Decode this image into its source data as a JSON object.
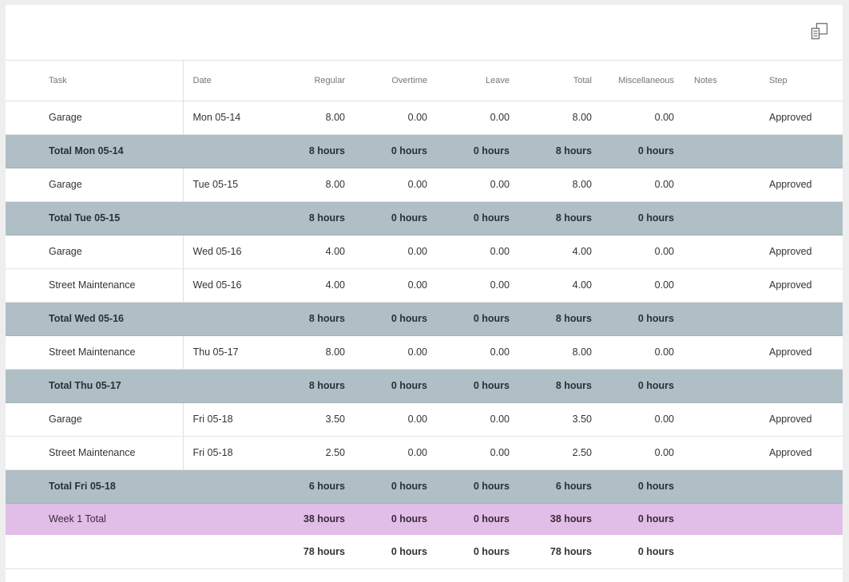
{
  "toolbar": {
    "export_icon": "columns-icon"
  },
  "columns": {
    "task": "Task",
    "date": "Date",
    "regular": "Regular",
    "overtime": "Overtime",
    "leave": "Leave",
    "total": "Total",
    "misc": "Miscellaneous",
    "notes": "Notes",
    "step": "Step"
  },
  "rows": [
    {
      "type": "entry",
      "task": "Garage",
      "date": "Mon 05-14",
      "regular": "8.00",
      "overtime": "0.00",
      "leave": "0.00",
      "total": "8.00",
      "misc": "0.00",
      "notes": "",
      "step": "Approved"
    },
    {
      "type": "subtotal",
      "label": "Total Mon 05-14",
      "regular": "8 hours",
      "overtime": "0 hours",
      "leave": "0 hours",
      "total": "8 hours",
      "misc": "0 hours"
    },
    {
      "type": "entry",
      "task": "Garage",
      "date": "Tue 05-15",
      "regular": "8.00",
      "overtime": "0.00",
      "leave": "0.00",
      "total": "8.00",
      "misc": "0.00",
      "notes": "",
      "step": "Approved"
    },
    {
      "type": "subtotal",
      "label": "Total Tue 05-15",
      "regular": "8 hours",
      "overtime": "0 hours",
      "leave": "0 hours",
      "total": "8 hours",
      "misc": "0 hours"
    },
    {
      "type": "entry",
      "task": "Garage",
      "date": "Wed 05-16",
      "regular": "4.00",
      "overtime": "0.00",
      "leave": "0.00",
      "total": "4.00",
      "misc": "0.00",
      "notes": "",
      "step": "Approved"
    },
    {
      "type": "entry",
      "task": "Street Maintenance",
      "date": "Wed 05-16",
      "regular": "4.00",
      "overtime": "0.00",
      "leave": "0.00",
      "total": "4.00",
      "misc": "0.00",
      "notes": "",
      "step": "Approved"
    },
    {
      "type": "subtotal",
      "label": "Total Wed 05-16",
      "regular": "8 hours",
      "overtime": "0 hours",
      "leave": "0 hours",
      "total": "8 hours",
      "misc": "0 hours"
    },
    {
      "type": "entry",
      "task": "Street Maintenance",
      "date": "Thu 05-17",
      "regular": "8.00",
      "overtime": "0.00",
      "leave": "0.00",
      "total": "8.00",
      "misc": "0.00",
      "notes": "",
      "step": "Approved"
    },
    {
      "type": "subtotal",
      "label": "Total Thu 05-17",
      "regular": "8 hours",
      "overtime": "0 hours",
      "leave": "0 hours",
      "total": "8 hours",
      "misc": "0 hours"
    },
    {
      "type": "entry",
      "task": "Garage",
      "date": "Fri 05-18",
      "regular": "3.50",
      "overtime": "0.00",
      "leave": "0.00",
      "total": "3.50",
      "misc": "0.00",
      "notes": "",
      "step": "Approved"
    },
    {
      "type": "entry",
      "task": "Street Maintenance",
      "date": "Fri 05-18",
      "regular": "2.50",
      "overtime": "0.00",
      "leave": "0.00",
      "total": "2.50",
      "misc": "0.00",
      "notes": "",
      "step": "Approved"
    },
    {
      "type": "subtotal",
      "label": "Total Fri 05-18",
      "regular": "6 hours",
      "overtime": "0 hours",
      "leave": "0 hours",
      "total": "6 hours",
      "misc": "0 hours"
    },
    {
      "type": "week",
      "label": "Week 1 Total",
      "regular": "38 hours",
      "overtime": "0 hours",
      "leave": "0 hours",
      "total": "38 hours",
      "misc": "0 hours"
    },
    {
      "type": "grand",
      "label": "",
      "regular": "78 hours",
      "overtime": "0 hours",
      "leave": "0 hours",
      "total": "78 hours",
      "misc": "0 hours"
    }
  ],
  "colors": {
    "subtotal_bg": "#b0bec5",
    "week_bg": "#e1bee7"
  }
}
